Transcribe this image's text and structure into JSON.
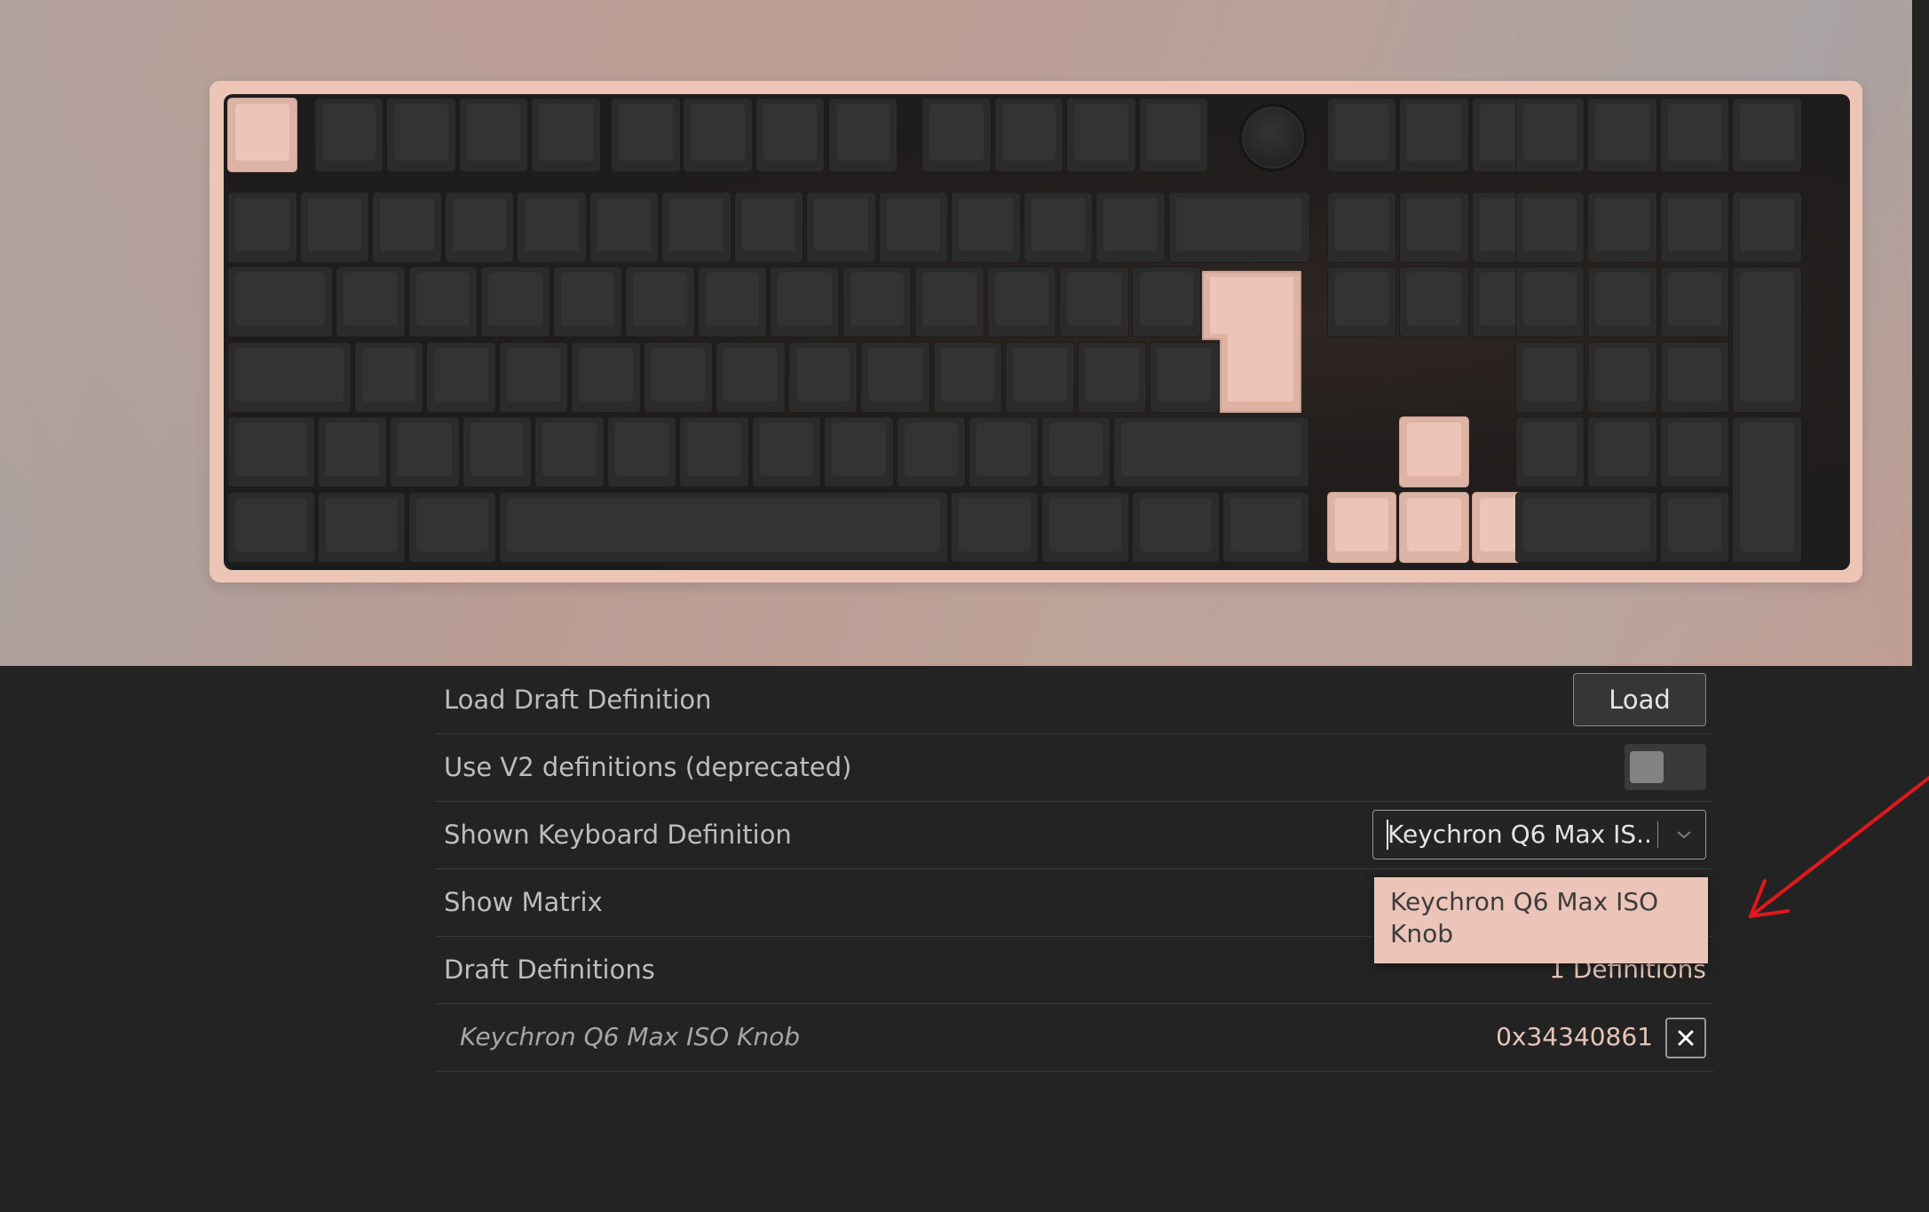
{
  "settings": {
    "load_draft": {
      "label": "Load Draft Definition",
      "button_label": "Load"
    },
    "use_v2": {
      "label": "Use V2 definitions (deprecated)",
      "enabled": false
    },
    "shown_definition": {
      "label": "Shown Keyboard Definition",
      "selected_value": "Keychron Q6 Max IS...",
      "options": [
        "Keychron Q6 Max ISO Knob"
      ]
    },
    "show_matrix": {
      "label": "Show Matrix"
    },
    "draft_definitions": {
      "label": "Draft Definitions",
      "count_text": "1 Definitions",
      "items": [
        {
          "name": "Keychron Q6 Max ISO Knob",
          "id": "0x34340861"
        }
      ]
    }
  },
  "icons": [
    "chevron-down-icon",
    "close-icon",
    "annotation-arrow"
  ],
  "colors": {
    "accent": "#ecc5b8",
    "keycap": "#2b2b2b",
    "panel_bg": "#232323",
    "annotation": "#e0181b"
  }
}
